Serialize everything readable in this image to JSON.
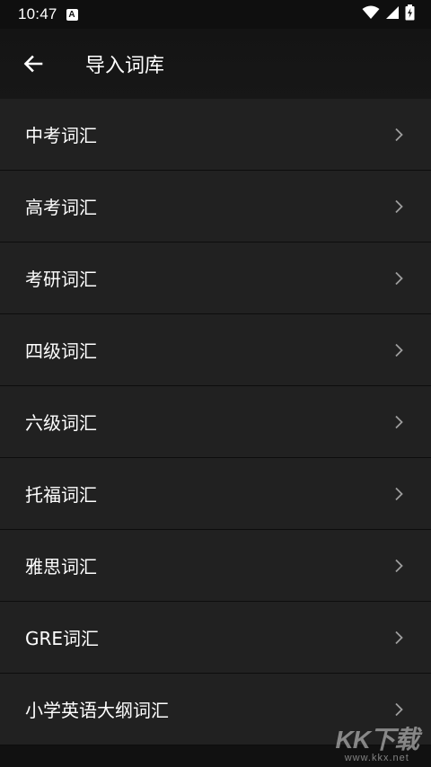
{
  "status_bar": {
    "time": "10:47",
    "notification_icon": "a-box-icon",
    "wifi_icon": "wifi-icon",
    "signal_icon": "cell-signal-icon",
    "battery_icon": "battery-charging-icon"
  },
  "app_bar": {
    "back_icon": "arrow-left-icon",
    "title": "导入词库"
  },
  "list": {
    "items": [
      {
        "label": "中考词汇"
      },
      {
        "label": "高考词汇"
      },
      {
        "label": "考研词汇"
      },
      {
        "label": "四级词汇"
      },
      {
        "label": "六级词汇"
      },
      {
        "label": "托福词汇"
      },
      {
        "label": "雅思词汇"
      },
      {
        "label": "GRE词汇"
      },
      {
        "label": "小学英语大纲词汇"
      }
    ],
    "chevron_icon": "chevron-right-icon"
  },
  "watermark": {
    "logo": "KK下载",
    "url": "www.kkx.net"
  },
  "colors": {
    "background": "#111111",
    "list_item_bg": "#212121",
    "divider": "#0d0d0d",
    "text": "#ffffff",
    "chevron": "#9e9e9e"
  }
}
